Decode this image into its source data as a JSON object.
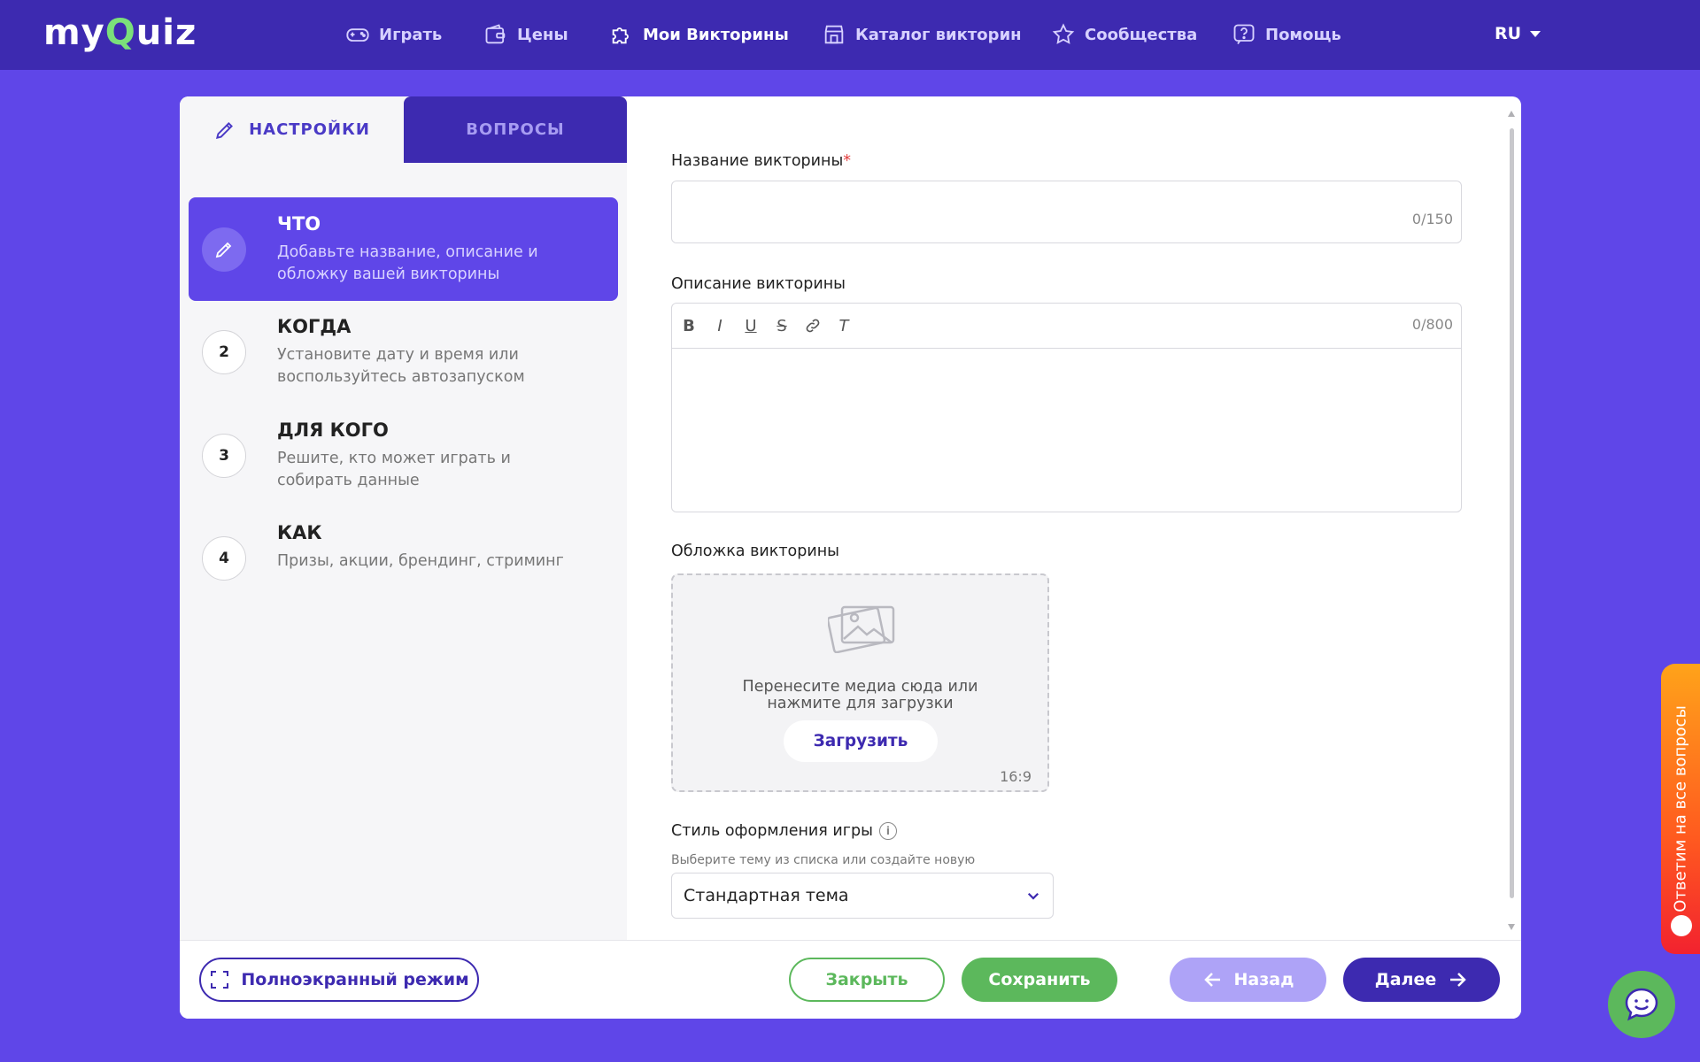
{
  "nav": {
    "logo": "myQuiz",
    "items": [
      {
        "label": "Играть",
        "icon": "gamepad-icon"
      },
      {
        "label": "Цены",
        "icon": "wallet-icon"
      },
      {
        "label": "Мои Викторины",
        "icon": "puzzle-icon"
      },
      {
        "label": "Каталог викторин",
        "icon": "store-icon"
      },
      {
        "label": "Сообщества",
        "icon": "star-icon"
      },
      {
        "label": "Помощь",
        "icon": "help-icon"
      }
    ],
    "language": "RU"
  },
  "tabs": {
    "settings": "НАСТРОЙКИ",
    "questions": "ВОПРОСЫ"
  },
  "steps": [
    {
      "badge": "",
      "title": "ЧТО",
      "desc": "Добавьте название, описание и обложку вашей викторины"
    },
    {
      "badge": "2",
      "title": "КОГДА",
      "desc": "Установите дату и время или воспользуйтесь автозапуском"
    },
    {
      "badge": "3",
      "title": "ДЛЯ КОГО",
      "desc": "Решите, кто может играть и собирать данные"
    },
    {
      "badge": "4",
      "title": "КАК",
      "desc": "Призы, акции, брендинг, стриминг"
    }
  ],
  "form": {
    "title_label": "Название викторины",
    "required_mark": "*",
    "title_value": "",
    "title_counter": "0/150",
    "desc_label": "Описание викторины",
    "desc_counter": "0/800",
    "toolbar": {
      "bold": "B",
      "italic": "I",
      "underline": "U",
      "strike": "S",
      "clear": "T"
    },
    "cover_label": "Обложка викторины",
    "dropzone_line1": "Перенесите медиа сюда или",
    "dropzone_line2": "нажмите для загрузки",
    "upload_label": "Загрузить",
    "ratio": "16:9",
    "style_label": "Стиль оформления игры",
    "style_info": "i",
    "style_hint": "Выберите тему из списка или создайте новую",
    "style_selected": "Стандартная тема"
  },
  "footer": {
    "fullscreen": "Полноэкранный режим",
    "close": "Закрыть",
    "save": "Сохранить",
    "back": "Назад",
    "next": "Далее"
  },
  "side_tab": "Ответим на все вопросы",
  "colors": {
    "nav_bg": "#3d2ab0",
    "page_bg": "#5f46e8",
    "accent": "#3d2ab0",
    "green": "#5cb85c"
  }
}
